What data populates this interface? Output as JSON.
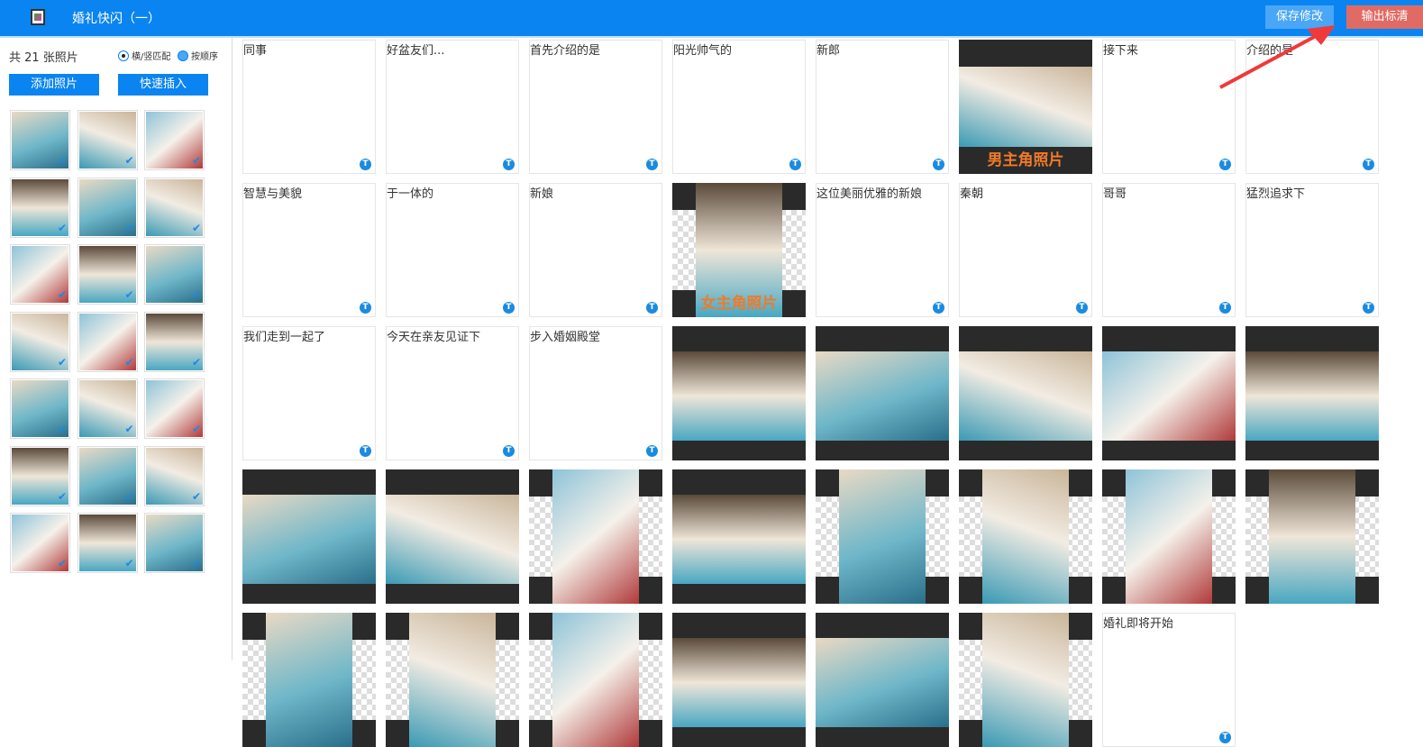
{
  "header": {
    "title": "婚礼快闪（一）",
    "save_label": "保存修改",
    "export_label": "输出标清"
  },
  "sidebar": {
    "count_label": "共 21 张照片",
    "radio_match": "横/竖匹配",
    "radio_order": "按顺序",
    "add_photo": "添加照片",
    "quick_insert": "快速插入",
    "thumbnail_count": 21
  },
  "grid": {
    "cells": [
      {
        "type": "text",
        "text": "同事"
      },
      {
        "type": "text",
        "text": "好盆友们..."
      },
      {
        "type": "text",
        "text": "首先介绍的是"
      },
      {
        "type": "text",
        "text": "阳光帅气的"
      },
      {
        "type": "text",
        "text": "新郎"
      },
      {
        "type": "photo",
        "caption": "男主角照片",
        "style": "full"
      },
      {
        "type": "text",
        "text": "接下来"
      },
      {
        "type": "text",
        "text": "介绍的是"
      },
      {
        "type": "text",
        "text": "智慧与美貌"
      },
      {
        "type": "text",
        "text": "于一体的"
      },
      {
        "type": "text",
        "text": "新娘"
      },
      {
        "type": "photo",
        "caption": "女主角照片",
        "style": "portrait"
      },
      {
        "type": "text",
        "text": "这位美丽优雅的新娘"
      },
      {
        "type": "text",
        "text": "秦朝"
      },
      {
        "type": "text",
        "text": "哥哥"
      },
      {
        "type": "text",
        "text": "猛烈追求下"
      },
      {
        "type": "text",
        "text": "我们走到一起了"
      },
      {
        "type": "text",
        "text": "今天在亲友见证下"
      },
      {
        "type": "text",
        "text": "步入婚姻殿堂"
      },
      {
        "type": "photo",
        "style": "landscape"
      },
      {
        "type": "photo",
        "style": "landscape"
      },
      {
        "type": "photo",
        "style": "landscape"
      },
      {
        "type": "photo",
        "style": "landscape"
      },
      {
        "type": "photo",
        "style": "landscape"
      },
      {
        "type": "photo",
        "style": "landscape"
      },
      {
        "type": "photo",
        "style": "landscape"
      },
      {
        "type": "photo",
        "style": "portrait"
      },
      {
        "type": "photo",
        "style": "landscape"
      },
      {
        "type": "photo",
        "style": "portrait"
      },
      {
        "type": "photo",
        "style": "portrait"
      },
      {
        "type": "photo",
        "style": "portrait"
      },
      {
        "type": "photo",
        "style": "portrait"
      },
      {
        "type": "photo",
        "style": "portrait"
      },
      {
        "type": "photo",
        "style": "portrait"
      },
      {
        "type": "photo",
        "style": "portrait"
      },
      {
        "type": "photo",
        "style": "landscape"
      },
      {
        "type": "photo",
        "style": "landscape"
      },
      {
        "type": "photo",
        "style": "portrait"
      },
      {
        "type": "text",
        "text": "婚礼即将开始"
      }
    ]
  },
  "colors": {
    "accent": "#0a84f0",
    "export": "#e06b64",
    "caption": "#f07a2a"
  }
}
